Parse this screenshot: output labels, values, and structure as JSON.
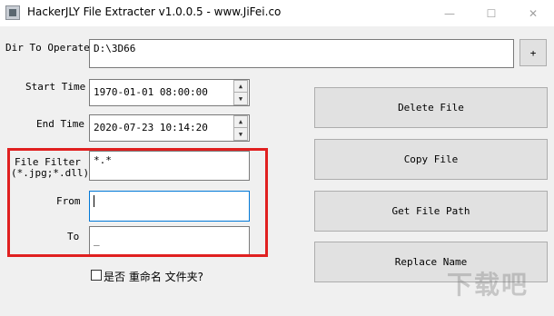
{
  "window": {
    "title": "HackerJLY File Extracter v1.0.0.5 - www.JiFei.co",
    "minimize_glyph": "—",
    "maximize_glyph": "☐",
    "close_glyph": "✕"
  },
  "form": {
    "dir_label": "Dir To Operate",
    "dir_value": "D:\\3D66",
    "browse_label": "+",
    "start_label": "Start Time",
    "start_value": "1970-01-01 08:00:00",
    "end_label": "End Time",
    "end_value": "2020-07-23 10:14:20",
    "filter_label_1": "File Filter",
    "filter_label_2": "(*.jpg;*.dll)",
    "filter_value": "*.*",
    "from_label": "From",
    "from_value": "",
    "to_label": "To",
    "to_value": "_",
    "checkbox_label": "是否 重命名 文件夹?"
  },
  "actions": {
    "delete": "Delete File",
    "copy": "Copy File",
    "path": "Get File Path",
    "replace": "Replace Name"
  },
  "spinner": {
    "up": "▲",
    "down": "▼"
  },
  "watermark": "下载吧"
}
